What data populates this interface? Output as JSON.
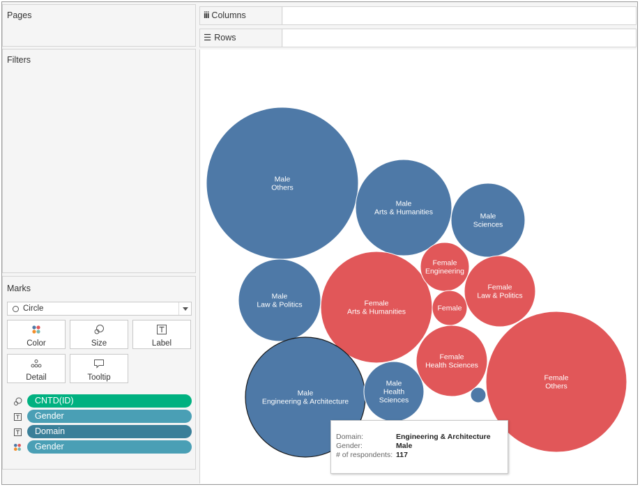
{
  "shelves": {
    "pages": "Pages",
    "filters": "Filters",
    "columns": "Columns",
    "rows": "Rows"
  },
  "marks": {
    "title": "Marks",
    "mark_type": "Circle",
    "cards": {
      "color": "Color",
      "size": "Size",
      "label": "Label",
      "detail": "Detail",
      "tooltip": "Tooltip"
    },
    "fields": [
      {
        "icon": "size-icon",
        "name": "CNTD(ID)",
        "color": "#00b180"
      },
      {
        "icon": "text-icon",
        "name": "Gender",
        "color": "#4a9fb5"
      },
      {
        "icon": "text-icon",
        "name": "Domain",
        "color": "#3a7f99"
      },
      {
        "icon": "color-icon",
        "name": "Gender",
        "color": "#4a9fb5"
      }
    ]
  },
  "colors": {
    "male": "#4e79a7",
    "female": "#e15759"
  },
  "bubbles": [
    {
      "gender": "Male",
      "domain": "Others"
    },
    {
      "gender": "Male",
      "domain": "Arts & Humanities"
    },
    {
      "gender": "Male",
      "domain": "Sciences"
    },
    {
      "gender": "Male",
      "domain": "Law & Politics"
    },
    {
      "gender": "Female",
      "domain": "Arts & Humanities"
    },
    {
      "gender": "Female",
      "domain": "Engineering"
    },
    {
      "gender": "Female",
      "domain": ""
    },
    {
      "gender": "Female",
      "domain": "Law & Politics"
    },
    {
      "gender": "Female",
      "domain": "Health Sciences"
    },
    {
      "gender": "Female",
      "domain": "Others"
    },
    {
      "gender": "Male",
      "domain": "Engineering & Architecture"
    },
    {
      "gender": "Male",
      "domain": "Health Sciences"
    },
    {
      "gender": "Male",
      "domain": ""
    }
  ],
  "tooltip": {
    "domain_key": "Domain:",
    "domain_val": "Engineering & Architecture",
    "gender_key": "Gender:",
    "gender_val": "Male",
    "count_key": "# of respondents:",
    "count_val": "117"
  }
}
